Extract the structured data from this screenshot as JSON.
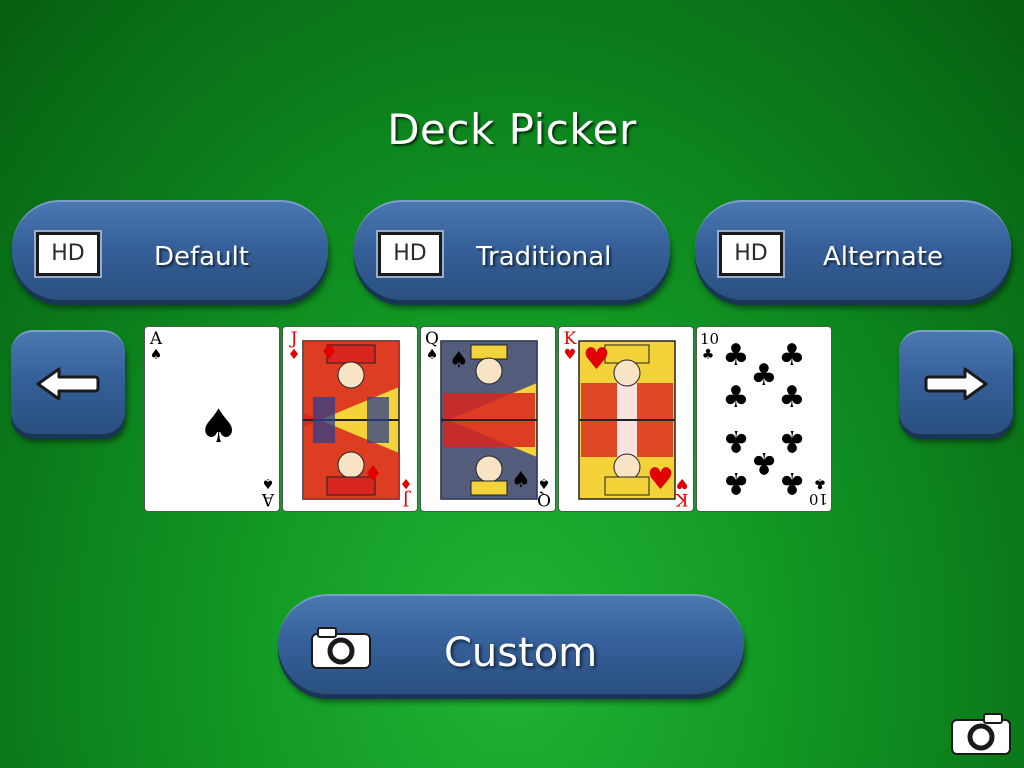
{
  "screen": {
    "title": "Deck Picker"
  },
  "decks": [
    {
      "badge": "HD",
      "label": "Default"
    },
    {
      "badge": "HD",
      "label": "Traditional"
    },
    {
      "badge": "HD",
      "label": "Alternate"
    }
  ],
  "nav": {
    "prev_icon": "arrow-left-icon",
    "next_icon": "arrow-right-icon"
  },
  "cards": [
    {
      "rank": "A",
      "suit": "spade",
      "suit_glyph": "♠"
    },
    {
      "rank": "J",
      "suit": "diamond",
      "suit_glyph": "♦"
    },
    {
      "rank": "Q",
      "suit": "spade",
      "suit_glyph": "♠"
    },
    {
      "rank": "K",
      "suit": "heart",
      "suit_glyph": "♥"
    },
    {
      "rank": "10",
      "suit": "club",
      "suit_glyph": "♣"
    }
  ],
  "custom": {
    "label": "Custom",
    "icon": "camera-icon"
  },
  "corner": {
    "icon": "camera-icon"
  },
  "colors": {
    "felt": "#129a25",
    "button": "#36609a",
    "red_suit": "#e00000"
  }
}
